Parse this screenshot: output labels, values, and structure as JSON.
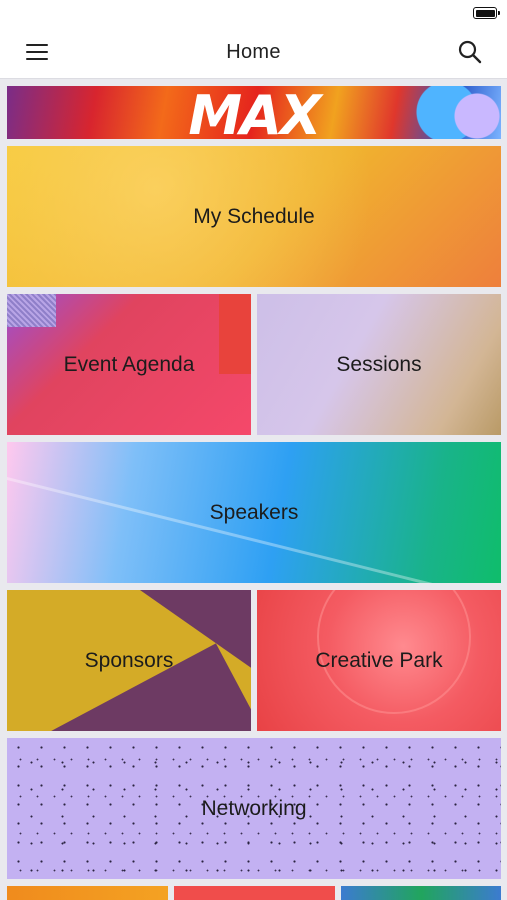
{
  "header": {
    "title": "Home"
  },
  "banner": {
    "text": "MAX"
  },
  "tiles": {
    "my_schedule": "My Schedule",
    "event_agenda": "Event Agenda",
    "sessions": "Sessions",
    "speakers": "Speakers",
    "sponsors": "Sponsors",
    "creative_park": "Creative Park",
    "networking": "Networking"
  },
  "icons": {
    "menu": "hamburger-menu-icon",
    "search": "search-icon",
    "battery": "battery-icon"
  },
  "colors": {
    "schedule": "#f0b22f",
    "event_agenda": "#f5486a",
    "speakers": "#2ea0f3",
    "sponsors": "#d4ab27",
    "creative_park": "#f45b62",
    "networking": "#c3b1f2"
  }
}
